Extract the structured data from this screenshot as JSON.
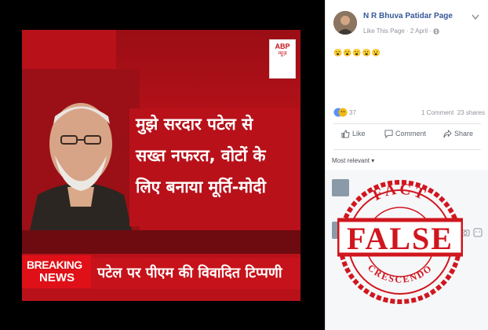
{
  "left": {
    "channel_logo": "ABP",
    "channel_sub": "न्यूज़",
    "headline_lines": [
      "मुझे सरदार पटेल से",
      "सख्त नफरत, वोटों के",
      "लिए बनाया मूर्ति-मोदी"
    ],
    "breaking_1": "BREAKING",
    "breaking_2": "NEWS",
    "ticker": "पटेल पर पीएम की विवादित टिप्पणी"
  },
  "post": {
    "page_name": "N R Bhuva Patidar Page",
    "like_link": "Like This Page",
    "date": "· 2 April ·",
    "emojis": "😮😮😮😮😮",
    "reaction_count": "37",
    "comments": "1 Comment",
    "shares": "23 shares",
    "like_label": "Like",
    "comment_label": "Comment",
    "share_label": "Share",
    "sort_label": "Most relevant ▾"
  },
  "stamp": {
    "top": "FACT",
    "middle": "FALSE",
    "bottom": "CRESCENDO"
  },
  "colors": {
    "fb_blue": "#365899",
    "tv_red": "#b8111a",
    "stamp_red": "#d0161e"
  }
}
